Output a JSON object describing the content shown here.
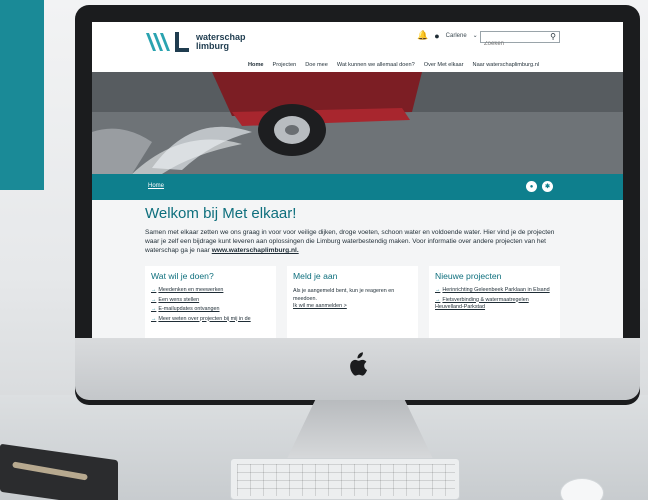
{
  "site": {
    "logo_line1": "waterschap",
    "logo_line2": "limburg"
  },
  "header": {
    "user_name": "Carlene",
    "search_placeholder": "Zoeken"
  },
  "nav": [
    "Home",
    "Projecten",
    "Doe mee",
    "Wat kunnen we allemaal doen?",
    "Over Met elkaar",
    "Naar waterschaplimburg.nl"
  ],
  "breadcrumb": {
    "home": "Home"
  },
  "page": {
    "title": "Welkom bij Met elkaar!",
    "intro_text": "Samen met elkaar zetten we ons graag in voor voor veilige dijken, droge voeten, schoon water en voldoende water. Hier vind je de projecten waar je zelf een bijdrage kunt leveren aan oplossingen die Limburg waterbestendig maken. Voor informatie over andere projecten van het waterschap ga je naar ",
    "intro_link": "www.waterschaplimburg.nl."
  },
  "cards": {
    "what": {
      "title": "Wat wil je doen?",
      "links": [
        "Meedenken en meewerken",
        "Een wens stellen",
        "E-mailupdates ontvangen",
        "Meer weten over projecten bij mij in de"
      ]
    },
    "signup": {
      "title": "Meld je aan",
      "text": "Als je aangemeld bent, kun je reageren en meedoen.",
      "link": "Ik wil me aanmelden >"
    },
    "projects": {
      "title": "Nieuwe projecten",
      "links": [
        "Herinrichting Geleenbeek Parklaan in Elsand",
        "Fietsverbinding & watermaatregelen Heuvelland-Parkstad"
      ]
    }
  },
  "colors": {
    "brand_teal": "#0e7f8d",
    "title_teal": "#0e6f7d"
  }
}
